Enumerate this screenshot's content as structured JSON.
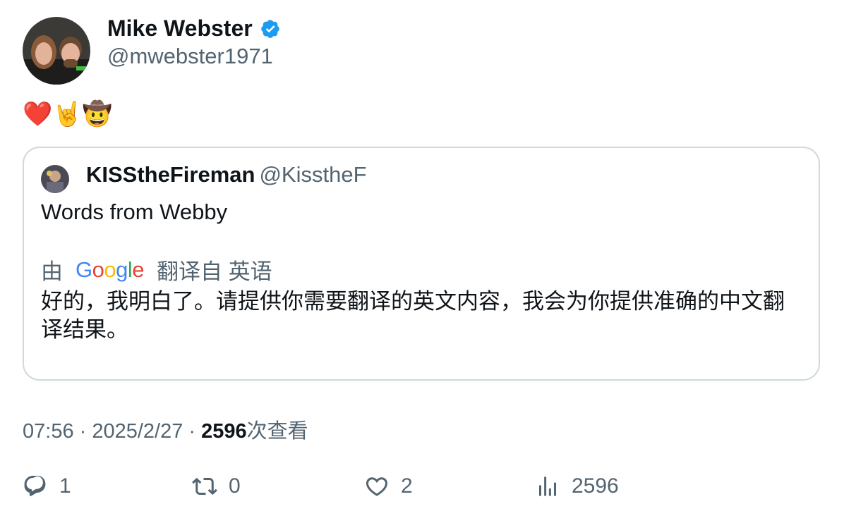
{
  "author": {
    "name": "Mike Webster",
    "handle": "@mwebster1971",
    "verified_icon": "verified-badge-icon",
    "accent": "#1d9bf0"
  },
  "tweet_emojis": "❤️🤘🤠",
  "quoted": {
    "name": "KISStheFireman",
    "handle": "@KisstheF",
    "text": "Words from Webby",
    "translate_prefix": "由",
    "translate_brand": "Google",
    "translate_suffix": "翻译自 英语",
    "translation": "好的，我明白了。请提供你需要翻译的英文内容，我会为你提供准确的中文翻译结果。"
  },
  "meta": {
    "time": "07:56",
    "sep1": " · ",
    "date": "2025/2/27",
    "sep2": " · ",
    "views_count": "2596",
    "views_label": "次查看"
  },
  "actions": {
    "replies": "1",
    "retweets": "0",
    "likes": "2",
    "views": "2596"
  }
}
